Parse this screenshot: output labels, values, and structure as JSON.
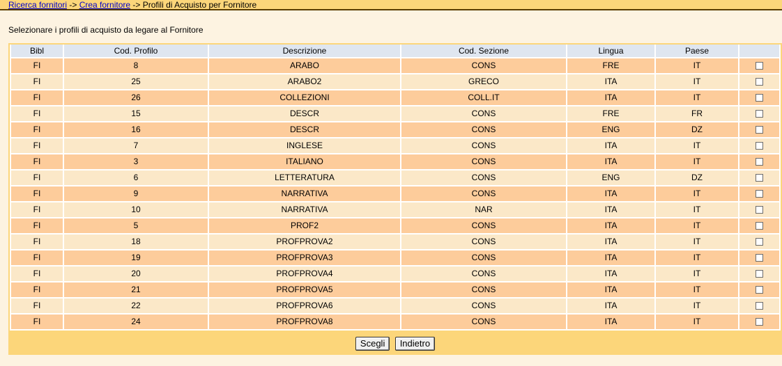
{
  "breadcrumb": {
    "link1": "Ricerca fornitori",
    "sep1": " -> ",
    "link2": "Crea fornitore",
    "sep2": " -> ",
    "current": "Profili di Acquisto per Fornitore"
  },
  "intro": "Selezionare i profili di acquisto da legare al Fornitore",
  "table": {
    "headers": [
      "Bibl",
      "Cod. Profilo",
      "Descrizione",
      "Cod. Sezione",
      "Lingua",
      "Paese",
      ""
    ],
    "rows": [
      {
        "bibl": "FI",
        "cod": "8",
        "descr": "ARABO",
        "sezione": "CONS",
        "lingua": "FRE",
        "paese": "IT"
      },
      {
        "bibl": "FI",
        "cod": "25",
        "descr": "ARABO2",
        "sezione": "GRECO",
        "lingua": "ITA",
        "paese": "IT"
      },
      {
        "bibl": "FI",
        "cod": "26",
        "descr": "COLLEZIONI",
        "sezione": "COLL.IT",
        "lingua": "ITA",
        "paese": "IT"
      },
      {
        "bibl": "FI",
        "cod": "15",
        "descr": "DESCR",
        "sezione": "CONS",
        "lingua": "FRE",
        "paese": "FR"
      },
      {
        "bibl": "FI",
        "cod": "16",
        "descr": "DESCR",
        "sezione": "CONS",
        "lingua": "ENG",
        "paese": "DZ"
      },
      {
        "bibl": "FI",
        "cod": "7",
        "descr": "INGLESE",
        "sezione": "CONS",
        "lingua": "ITA",
        "paese": "IT"
      },
      {
        "bibl": "FI",
        "cod": "3",
        "descr": "ITALIANO",
        "sezione": "CONS",
        "lingua": "ITA",
        "paese": "IT"
      },
      {
        "bibl": "FI",
        "cod": "6",
        "descr": "LETTERATURA",
        "sezione": "CONS",
        "lingua": "ENG",
        "paese": "DZ"
      },
      {
        "bibl": "FI",
        "cod": "9",
        "descr": "NARRATIVA",
        "sezione": "CONS",
        "lingua": "ITA",
        "paese": "IT"
      },
      {
        "bibl": "FI",
        "cod": "10",
        "descr": "NARRATIVA",
        "sezione": "NAR",
        "lingua": "ITA",
        "paese": "IT"
      },
      {
        "bibl": "FI",
        "cod": "5",
        "descr": "PROF2",
        "sezione": "CONS",
        "lingua": "ITA",
        "paese": "IT"
      },
      {
        "bibl": "FI",
        "cod": "18",
        "descr": "PROFPROVA2",
        "sezione": "CONS",
        "lingua": "ITA",
        "paese": "IT"
      },
      {
        "bibl": "FI",
        "cod": "19",
        "descr": "PROFPROVA3",
        "sezione": "CONS",
        "lingua": "ITA",
        "paese": "IT"
      },
      {
        "bibl": "FI",
        "cod": "20",
        "descr": "PROFPROVA4",
        "sezione": "CONS",
        "lingua": "ITA",
        "paese": "IT"
      },
      {
        "bibl": "FI",
        "cod": "21",
        "descr": "PROFPROVA5",
        "sezione": "CONS",
        "lingua": "ITA",
        "paese": "IT"
      },
      {
        "bibl": "FI",
        "cod": "22",
        "descr": "PROFPROVA6",
        "sezione": "CONS",
        "lingua": "ITA",
        "paese": "IT"
      },
      {
        "bibl": "FI",
        "cod": "24",
        "descr": "PROFPROVA8",
        "sezione": "CONS",
        "lingua": "ITA",
        "paese": "IT"
      }
    ]
  },
  "buttons": {
    "scegli": "Scegli",
    "indietro": "Indietro"
  },
  "colors": {
    "header_bar": "#fcd67a",
    "row_odd": "#fdcc9b",
    "row_even": "#fbe8c8",
    "table_header": "#dfe6f0",
    "page_bg": "#fdf3e1"
  }
}
